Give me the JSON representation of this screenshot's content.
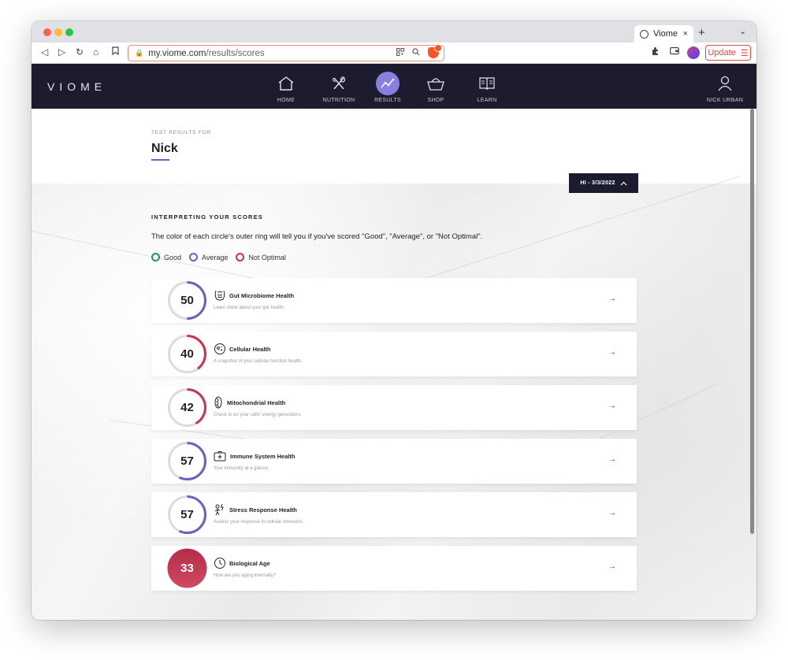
{
  "browser": {
    "tab_title": "Viome",
    "tab_close": "×",
    "new_tab": "+",
    "tab_menu": "⌄",
    "url_domain": "my.viome.com",
    "url_path": "/results/scores",
    "update_label": "Update",
    "update_menu": "☰"
  },
  "nav": {
    "logo": "VIOME",
    "items": [
      {
        "label": "HOME"
      },
      {
        "label": "NUTRITION"
      },
      {
        "label": "RESULTS"
      },
      {
        "label": "SHOP"
      },
      {
        "label": "LEARN"
      }
    ],
    "user_label": "NICK URBAN"
  },
  "header": {
    "test_results_for": "TEST RESULTS FOR",
    "name": "Nick",
    "date_button": "HI - 3/3/2022"
  },
  "interpreting": {
    "title": "INTERPRETING YOUR SCORES",
    "description": "The color of each circle's outer ring will tell you if you've scored \"Good\", \"Average\", or \"Not Optimal\".",
    "legend": [
      {
        "label": "Good",
        "color": "#1f8f7a"
      },
      {
        "label": "Average",
        "color": "#6d5fc4"
      },
      {
        "label": "Not Optimal",
        "color": "#c9344d"
      }
    ]
  },
  "colors": {
    "good": "#1f8f7a",
    "average": "#6d5fc4",
    "not_optimal": "#c9344d",
    "nav_bg": "#1d1b2e",
    "active_nav": "#8a7fe0"
  },
  "scores": [
    {
      "score": "50",
      "title": "Gut Microbiome Health",
      "subtitle": "Learn more about your gut health.",
      "status": "average",
      "fraction": 0.5,
      "icon": "gut-icon"
    },
    {
      "score": "40",
      "title": "Cellular Health",
      "subtitle": "A snapshot of your cellular function health.",
      "status": "not_optimal",
      "fraction": 0.4,
      "icon": "cell-icon"
    },
    {
      "score": "42",
      "title": "Mitochondrial Health",
      "subtitle": "Check in on your cells' energy generators.",
      "status": "not_optimal",
      "fraction": 0.42,
      "icon": "mitochondria-icon"
    },
    {
      "score": "57",
      "title": "Immune System Health",
      "subtitle": "Your immunity at a glance.",
      "status": "average",
      "fraction": 0.57,
      "icon": "first-aid-kit-icon"
    },
    {
      "score": "57",
      "title": "Stress Response Health",
      "subtitle": "Assess your response to cellular stressors.",
      "status": "average",
      "fraction": 0.57,
      "icon": "stress-icon"
    },
    {
      "score": "33",
      "title": "Biological Age",
      "subtitle": "How are you aging internally?",
      "status": "not_optimal",
      "fraction": 1,
      "icon": "clock-icon",
      "filled": true
    }
  ]
}
